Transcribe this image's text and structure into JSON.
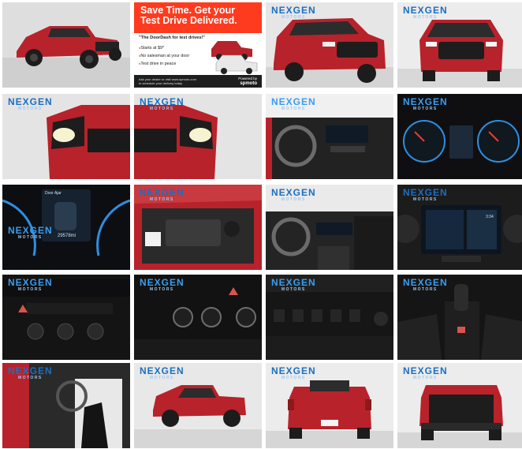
{
  "gallery": {
    "logo_text": "NEXGEN",
    "logo_sub": "MOTORS",
    "ad": {
      "headline_line1": "Save Time. Get your",
      "headline_line2": "Test Drive Delivered.",
      "tagline": "\"The DoorDash for test drives!\"",
      "bullets": [
        "Starts at $9*",
        "No salesman at your door",
        "Test drive in peace"
      ],
      "footer_line1": "Ask your dealer or visit www.spmoto.com",
      "footer_line2": "to schedule your delivery today",
      "powered_label": "Powered by",
      "powered_brand": "spmoto"
    },
    "dash": {
      "screen_label": "Door Ajar",
      "odometer": "29578mi",
      "time": "3:34"
    },
    "colors": {
      "truck_red": "#b8222b",
      "ad_orange": "#ff3b1f",
      "logo_blue": "#1b6fc0",
      "gauge_blue": "#2e8fe0"
    }
  }
}
